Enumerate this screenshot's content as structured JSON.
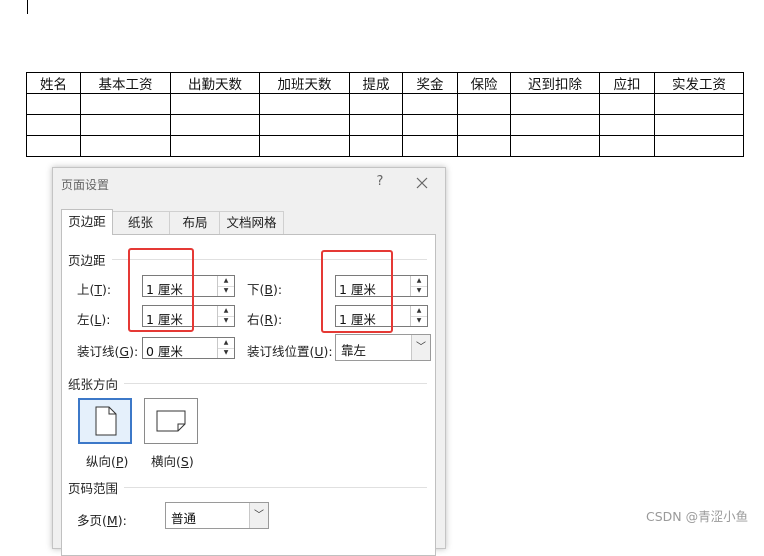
{
  "table": {
    "headers": [
      "姓名",
      "基本工资",
      "出勤天数",
      "加班天数",
      "提成",
      "奖金",
      "保险",
      "迟到扣除",
      "应扣",
      "实发工资"
    ],
    "empty_rows": 3
  },
  "dialog": {
    "title": "页面设置",
    "help": "?",
    "tabs": [
      "页边距",
      "纸张",
      "布局",
      "文档网格"
    ],
    "active_tab": "页边距",
    "margins": {
      "section": "页边距",
      "top_label": "上(T):",
      "top_value": "1 厘米",
      "bottom_label": "下(B):",
      "bottom_value": "1 厘米",
      "left_label": "左(L):",
      "left_value": "1 厘米",
      "right_label": "右(R):",
      "right_value": "1 厘米",
      "gutter_label": "装订线(G):",
      "gutter_value": "0 厘米",
      "gutter_pos_label": "装订线位置(U):",
      "gutter_pos_value": "靠左"
    },
    "orientation": {
      "section": "纸张方向",
      "portrait": "纵向(P)",
      "landscape": "横向(S)",
      "selected": "纵向(P)"
    },
    "pages": {
      "section": "页码范围",
      "multiple_label": "多页(M):",
      "multiple_value": "普通"
    }
  },
  "watermark": "CSDN @青涩小鱼",
  "colors": {
    "highlight": "#e53935",
    "selection": "#3c78c8"
  }
}
